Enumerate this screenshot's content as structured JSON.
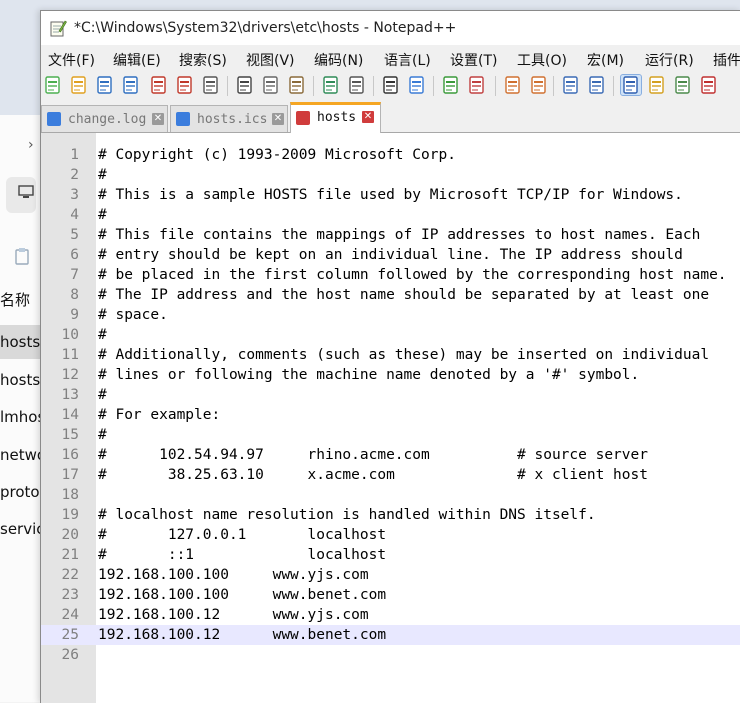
{
  "background_explorer": {
    "items": [
      {
        "label": "名称"
      },
      {
        "label": "hosts",
        "selected": true
      },
      {
        "label": "hosts"
      },
      {
        "label": "lmhosts"
      },
      {
        "label": "networks"
      },
      {
        "label": "protocol"
      },
      {
        "label": "services"
      }
    ]
  },
  "window": {
    "title": "*C:\\Windows\\System32\\drivers\\etc\\hosts - Notepad++"
  },
  "menu": [
    {
      "label": "文件(F)"
    },
    {
      "label": "编辑(E)"
    },
    {
      "label": "搜索(S)"
    },
    {
      "label": "视图(V)"
    },
    {
      "label": "编码(N)"
    },
    {
      "label": "语言(L)"
    },
    {
      "label": "设置(T)"
    },
    {
      "label": "工具(O)"
    },
    {
      "label": "宏(M)"
    },
    {
      "label": "运行(R)"
    },
    {
      "label": "插件"
    }
  ],
  "toolbar": [
    {
      "icon": "new-file-icon",
      "color": "#4caf50"
    },
    {
      "icon": "open-file-icon",
      "color": "#e0a020"
    },
    {
      "icon": "save-icon",
      "color": "#2f6fc0"
    },
    {
      "icon": "save-all-icon",
      "color": "#2f6fc0"
    },
    {
      "icon": "close-icon",
      "color": "#c0392b"
    },
    {
      "icon": "close-all-icon",
      "color": "#c0392b"
    },
    {
      "icon": "print-icon",
      "color": "#555555"
    },
    {
      "icon": "cut-icon",
      "color": "#444444"
    },
    {
      "icon": "copy-icon",
      "color": "#666666"
    },
    {
      "icon": "paste-icon",
      "color": "#8a6a3a"
    },
    {
      "icon": "undo-icon",
      "color": "#2e8b57"
    },
    {
      "icon": "redo-icon",
      "color": "#555555"
    },
    {
      "icon": "find-icon",
      "color": "#333333"
    },
    {
      "icon": "replace-icon",
      "color": "#3a7bd5"
    },
    {
      "icon": "zoom-in-icon",
      "color": "#3a9a3a"
    },
    {
      "icon": "zoom-out-icon",
      "color": "#c04040"
    },
    {
      "icon": "sync-vertical-icon",
      "color": "#d07030"
    },
    {
      "icon": "sync-horizontal-icon",
      "color": "#d07030"
    },
    {
      "icon": "word-wrap-icon",
      "color": "#3a6ab5"
    },
    {
      "icon": "show-all-chars-icon",
      "color": "#3a6ab5"
    },
    {
      "icon": "indent-guide-icon",
      "color": "#2f5fb0",
      "active": true
    },
    {
      "icon": "folder-workspace-icon",
      "color": "#d4a020"
    },
    {
      "icon": "document-map-icon",
      "color": "#4a8a4a"
    },
    {
      "icon": "function-list-icon",
      "color": "#c03030"
    }
  ],
  "tabs": [
    {
      "label": "change.log",
      "active": false,
      "icon_color": "#3b7ddd"
    },
    {
      "label": "hosts.ics",
      "active": false,
      "icon_color": "#3b7ddd"
    },
    {
      "label": "hosts",
      "active": true,
      "icon_color": "#d03c3c"
    }
  ],
  "editor": {
    "current_line": 25,
    "lines": [
      "# Copyright (c) 1993-2009 Microsoft Corp.",
      "#",
      "# This is a sample HOSTS file used by Microsoft TCP/IP for Windows.",
      "#",
      "# This file contains the mappings of IP addresses to host names. Each",
      "# entry should be kept on an individual line. The IP address should",
      "# be placed in the first column followed by the corresponding host name.",
      "# The IP address and the host name should be separated by at least one",
      "# space.",
      "#",
      "# Additionally, comments (such as these) may be inserted on individual",
      "# lines or following the machine name denoted by a '#' symbol.",
      "#",
      "# For example:",
      "#",
      "#      102.54.94.97     rhino.acme.com          # source server",
      "#       38.25.63.10     x.acme.com              # x client host",
      "",
      "# localhost name resolution is handled within DNS itself.",
      "#\t127.0.0.1       localhost",
      "#\t::1             localhost",
      "192.168.100.100     www.yjs.com",
      "192.168.100.100     www.benet.com",
      "192.168.100.12      www.yjs.com",
      "192.168.100.12      www.benet.com",
      ""
    ]
  }
}
